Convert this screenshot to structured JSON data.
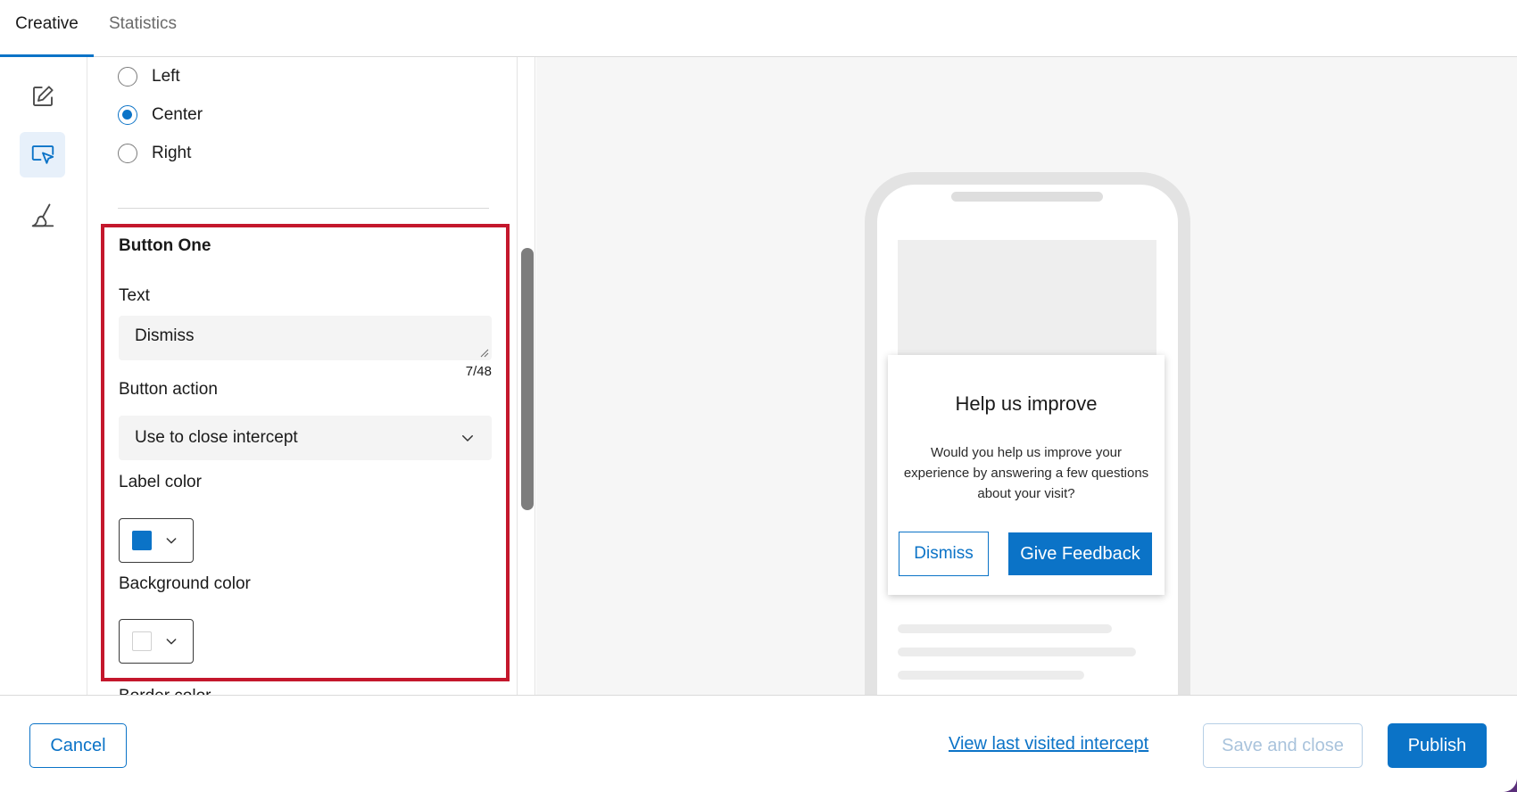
{
  "tabs": [
    {
      "label": "Creative",
      "active": true
    },
    {
      "label": "Statistics",
      "active": false
    }
  ],
  "rail": {
    "items": [
      {
        "icon": "edit-icon",
        "active": false
      },
      {
        "icon": "cursor-click-icon",
        "active": true
      },
      {
        "icon": "brush-icon",
        "active": false
      }
    ]
  },
  "alignment": {
    "options": [
      {
        "label": "Left",
        "checked": false
      },
      {
        "label": "Center",
        "checked": true
      },
      {
        "label": "Right",
        "checked": false
      }
    ]
  },
  "button_one": {
    "title": "Button One",
    "text_label": "Text",
    "text_value": "Dismiss",
    "char_count": "7/48",
    "action_label": "Button action",
    "action_value": "Use to close intercept",
    "label_color_label": "Label color",
    "label_color": "#0b73c7",
    "background_color_label": "Background color",
    "background_color": "#ffffff",
    "next_label_partial": "Border color"
  },
  "preview": {
    "title": "Help us improve",
    "body": "Would you help us improve your experience by answering a few questions about your visit?",
    "dismiss_label": "Dismiss",
    "feedback_label": "Give Feedback"
  },
  "footer": {
    "cancel_label": "Cancel",
    "view_last_label": "View last visited intercept",
    "save_close_label": "Save and close",
    "publish_label": "Publish"
  },
  "colors": {
    "accent": "#0b73c7",
    "highlight": "#c4172c"
  }
}
